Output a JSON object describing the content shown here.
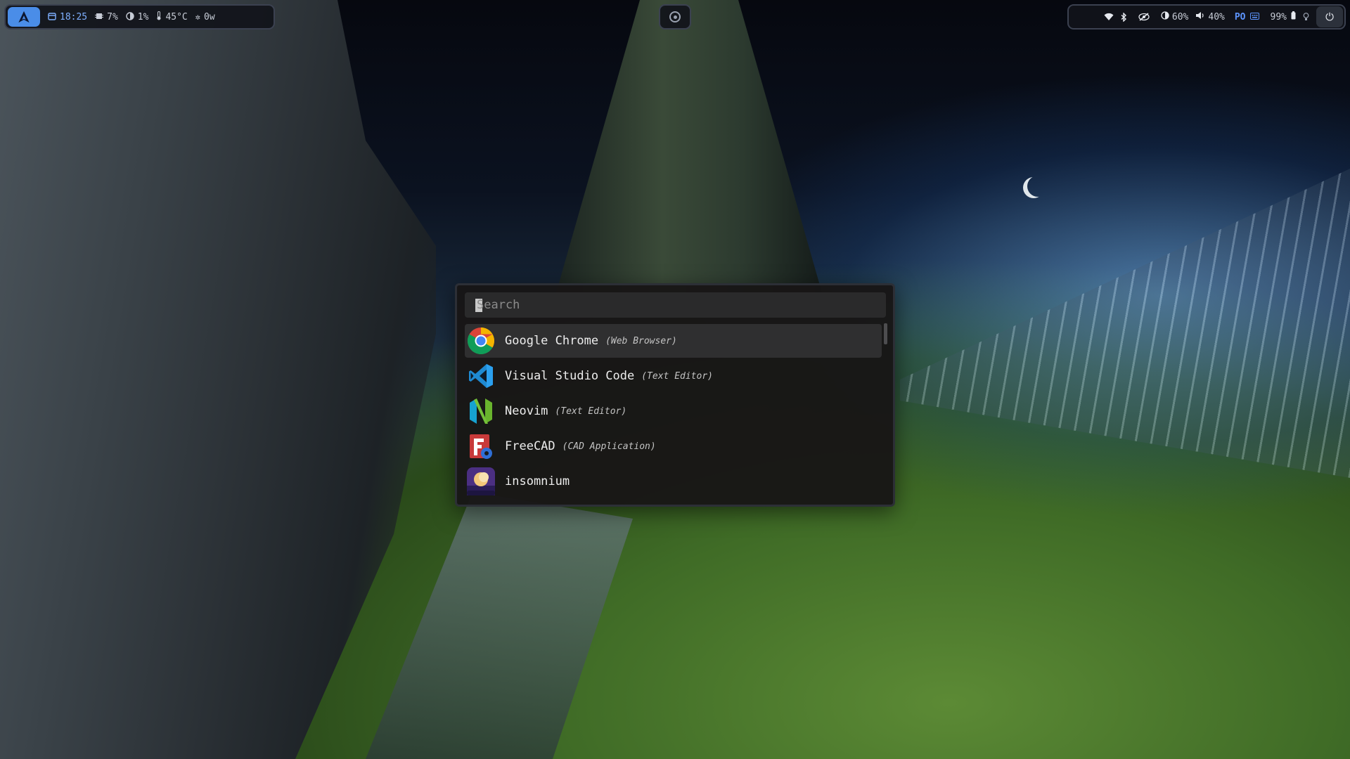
{
  "statusbar": {
    "left": {
      "launcher_icon": "arch-logo-icon",
      "clock": "18:25",
      "cpu": "7%",
      "memory": "1%",
      "temperature": "45°C",
      "power_draw": "0w"
    },
    "center": {
      "icon": "record-dot-icon"
    },
    "right": {
      "brightness": "60%",
      "volume": "40%",
      "keyboard_layout": "PO",
      "battery": "99%"
    }
  },
  "launcher": {
    "search": {
      "value": "",
      "placeholder": "Search"
    },
    "items": [
      {
        "name": "Google Chrome",
        "category": "(Web Browser)",
        "icon": "chrome-icon"
      },
      {
        "name": "Visual Studio Code",
        "category": "(Text Editor)",
        "icon": "vscode-icon"
      },
      {
        "name": "Neovim",
        "category": "(Text Editor)",
        "icon": "neovim-icon"
      },
      {
        "name": "FreeCAD",
        "category": "(CAD Application)",
        "icon": "freecad-icon"
      },
      {
        "name": "insomnium",
        "category": "",
        "icon": "insomnium-icon"
      }
    ],
    "selected_index": 0
  },
  "colors": {
    "accent": "#4a8de8",
    "launcher_bg": "#181616",
    "selected_row": "#2f2f30"
  }
}
